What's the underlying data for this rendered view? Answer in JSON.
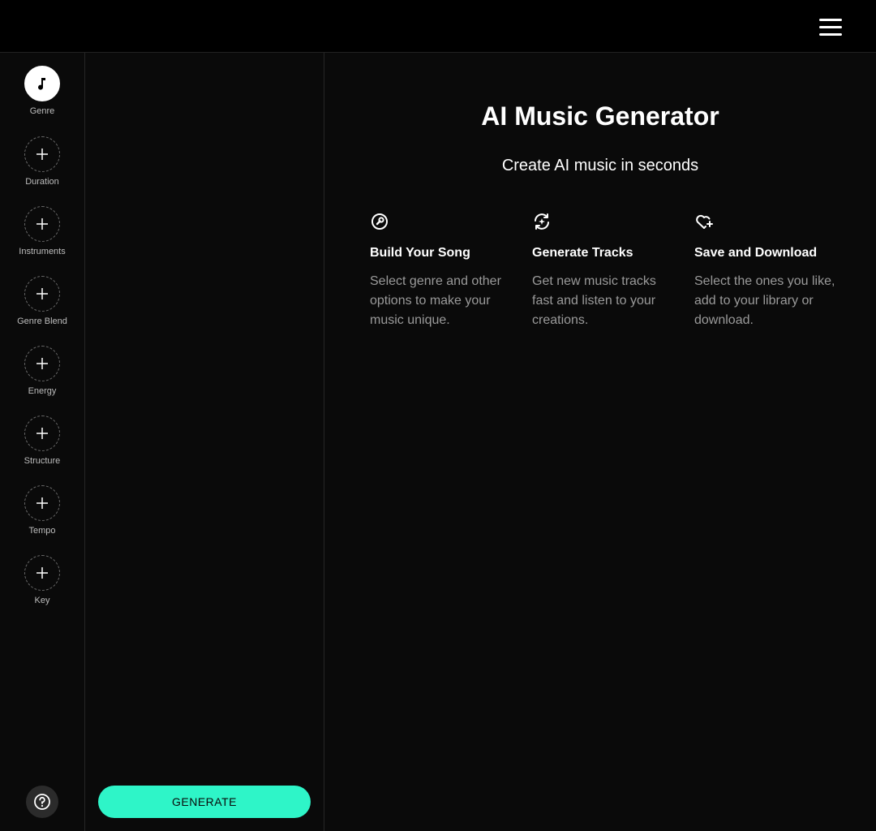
{
  "header": {
    "menu_icon": "hamburger-menu-icon"
  },
  "sidebar": {
    "items": [
      {
        "label": "Genre",
        "icon": "music-note-icon",
        "active": true
      },
      {
        "label": "Duration",
        "icon": "plus-icon",
        "active": false
      },
      {
        "label": "Instruments",
        "icon": "plus-icon",
        "active": false
      },
      {
        "label": "Genre Blend",
        "icon": "plus-icon",
        "active": false
      },
      {
        "label": "Energy",
        "icon": "plus-icon",
        "active": false
      },
      {
        "label": "Structure",
        "icon": "plus-icon",
        "active": false
      },
      {
        "label": "Tempo",
        "icon": "plus-icon",
        "active": false
      },
      {
        "label": "Key",
        "icon": "plus-icon",
        "active": false
      }
    ],
    "help_icon": "question-mark-icon"
  },
  "panel": {
    "generate_label": "GENERATE",
    "accent_color": "#2ef5c8"
  },
  "main": {
    "title": "AI Music Generator",
    "subtitle": "Create AI music in seconds",
    "features": [
      {
        "icon": "wrench-icon",
        "title": "Build Your Song",
        "description": "Select genre and other options to make your music unique."
      },
      {
        "icon": "sparkle-refresh-icon",
        "title": "Generate Tracks",
        "description": "Get new music tracks fast and listen to your creations."
      },
      {
        "icon": "heart-plus-icon",
        "title": "Save and Download",
        "description": "Select the ones you like, add to your library or download."
      }
    ]
  }
}
